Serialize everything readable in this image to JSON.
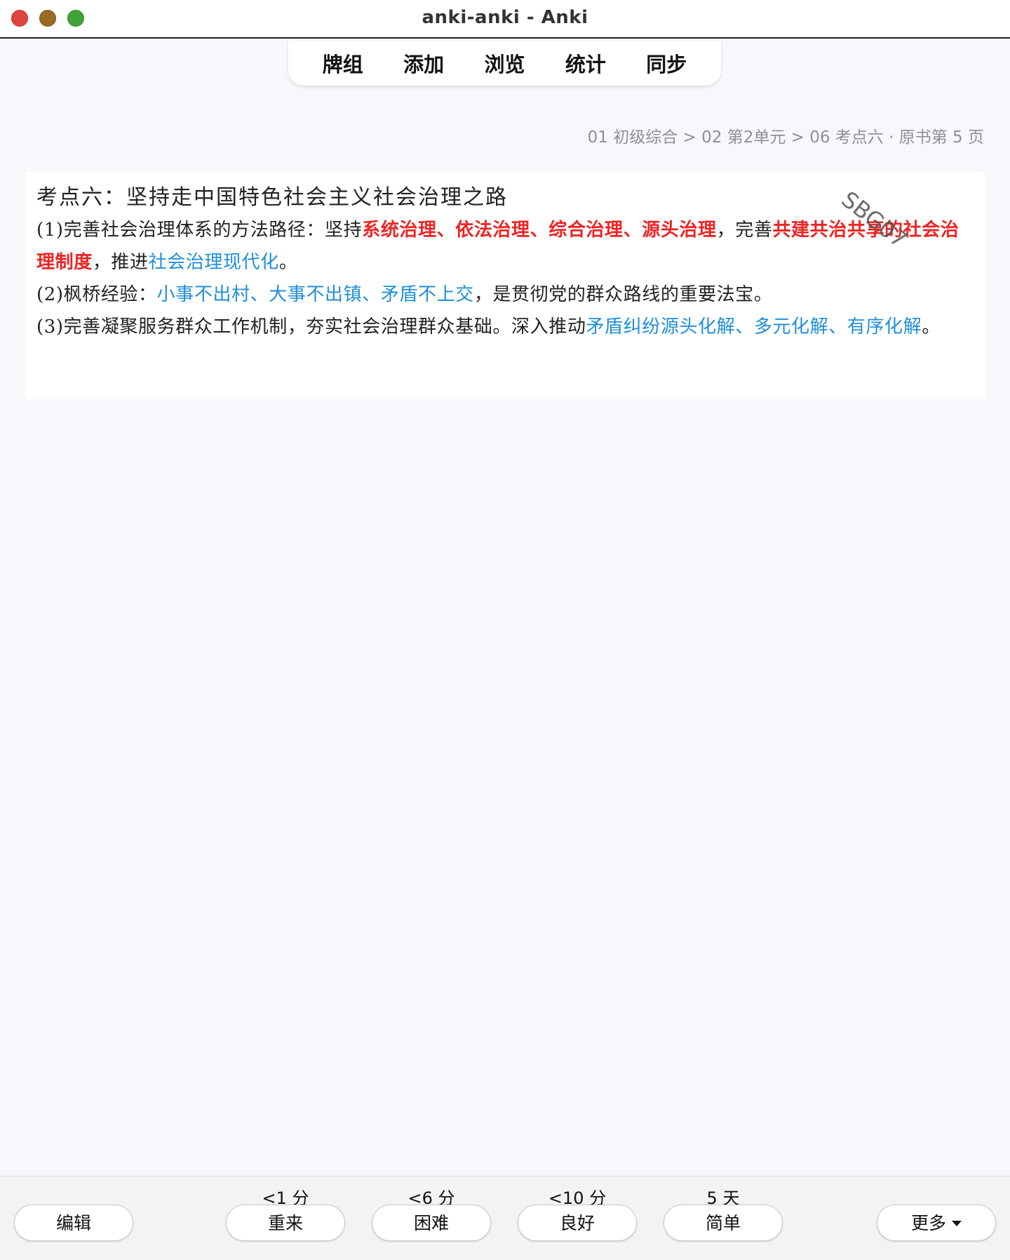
{
  "window": {
    "title": "anki-anki - Anki"
  },
  "nav": {
    "decks": "牌组",
    "add": "添加",
    "browse": "浏览",
    "stats": "统计",
    "sync": "同步"
  },
  "breadcrumb": "01 初级综合 > 02 第2单元 > 06 考点六 · 原书第 5 页",
  "card": {
    "heading": "考点六：坚持走中国特色社会主义社会治理之路",
    "watermark": "SBG07",
    "line1": {
      "prefix": "(1)完善社会治理体系的方法路径：坚持",
      "red1": "系统治理、依法治理、综合治理、源头治理",
      "mid": "，完善",
      "red2": "共建共治共享的社会治理制度",
      "mid2": "，推进",
      "blue1": "社会治理现代化",
      "end": "。"
    },
    "line2": {
      "prefix": "(2)枫桥经验：",
      "blue1": "小事不出村、大事不出镇、矛盾不上交",
      "suffix": "，是贯彻党的群众路线的重要法宝。"
    },
    "line3": {
      "prefix": "(3)完善凝聚服务群众工作机制，夯实社会治理群众基础。深入推动",
      "blue1": "矛盾纠纷源头化解、多元化解、有序化解",
      "end": "。"
    }
  },
  "bottombar": {
    "edit": "编辑",
    "again": {
      "label": "重来",
      "interval": "<1 分"
    },
    "hard": {
      "label": "困难",
      "interval": "<6 分"
    },
    "good": {
      "label": "良好",
      "interval": "<10 分"
    },
    "easy": {
      "label": "简单",
      "interval": "5 天"
    },
    "more": "更多"
  },
  "colors": {
    "red_highlight": "#ee2424",
    "blue_highlight": "#1f8fd8",
    "close": "#e0443e",
    "minimize": "#9b6a26",
    "maximize": "#3fa33a"
  }
}
